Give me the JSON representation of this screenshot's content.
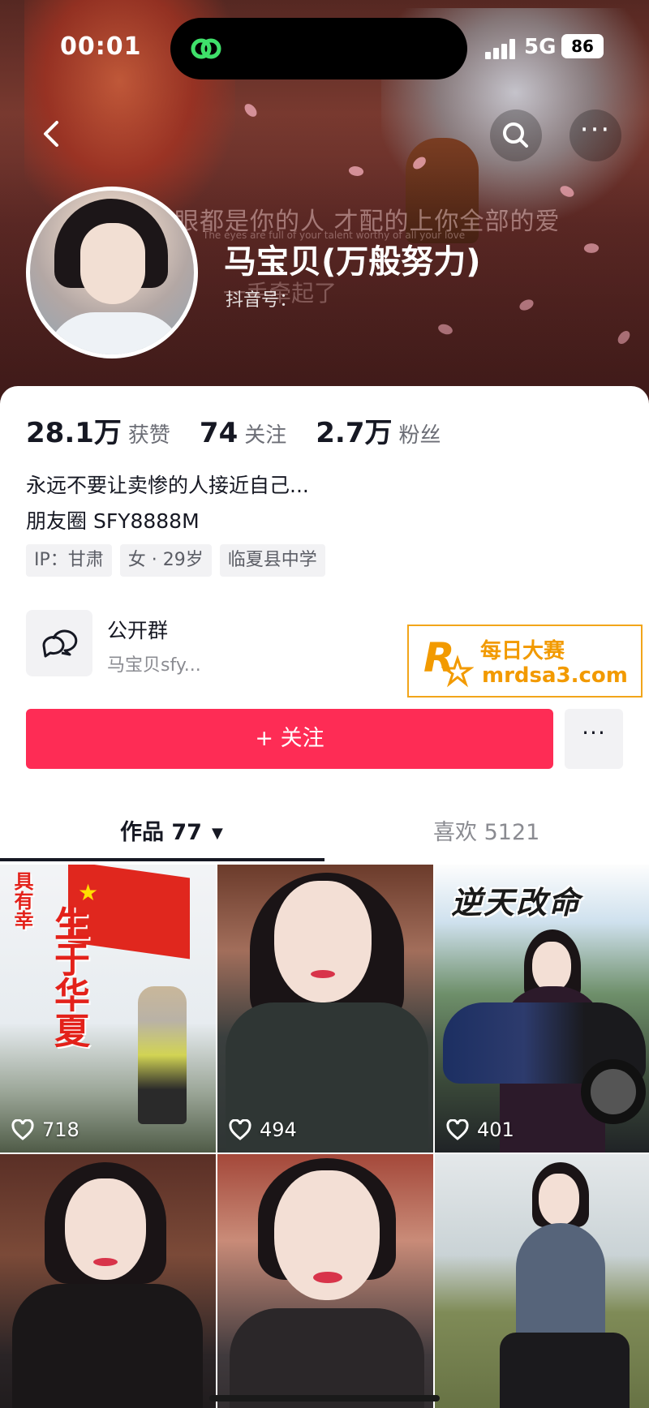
{
  "status_bar": {
    "time": "00:01",
    "network": "5G",
    "battery": "86"
  },
  "cover": {
    "poster_line": "眼都是你的人 才配的上你全部的爱",
    "poster_sub": "The eyes are full of your talent worthy of all your love",
    "poster_line2": "一手牵起了"
  },
  "profile": {
    "name": "马宝贝(万般努力)",
    "douyin_id": "抖音号：",
    "stats": [
      {
        "num": "28.1万",
        "label": "获赞"
      },
      {
        "num": "74",
        "label": "关注"
      },
      {
        "num": "2.7万",
        "label": "粉丝"
      }
    ],
    "bio_line1": "永远不要让卖惨的人接近自己...",
    "bio_line2": "朋友圈 SFY8888M",
    "tags": [
      "IP：甘肃",
      "女 · 29岁",
      "临夏县中学"
    ],
    "group": {
      "title": "公开群",
      "subtitle": "马宝贝sfy..."
    }
  },
  "watermark": {
    "title": "每日大赛",
    "url": "mrdsa3.com",
    "logo_text": "R",
    "logo_small": "每日大赛"
  },
  "actions": {
    "follow_label": "+ 关注",
    "more_label": "···"
  },
  "tabs": {
    "works_label": "作品 77",
    "likes_label": "喜欢 5121"
  },
  "videos": [
    {
      "likes": "718",
      "overlay_a": "具有幸",
      "overlay_b": "生于华夏"
    },
    {
      "likes": "494"
    },
    {
      "likes": "401",
      "banner": "逆天改命"
    },
    {
      "likes": ""
    },
    {
      "likes": ""
    },
    {
      "likes": ""
    }
  ],
  "colors": {
    "accent": "#fe2c55",
    "watermark": "#f29a00"
  }
}
